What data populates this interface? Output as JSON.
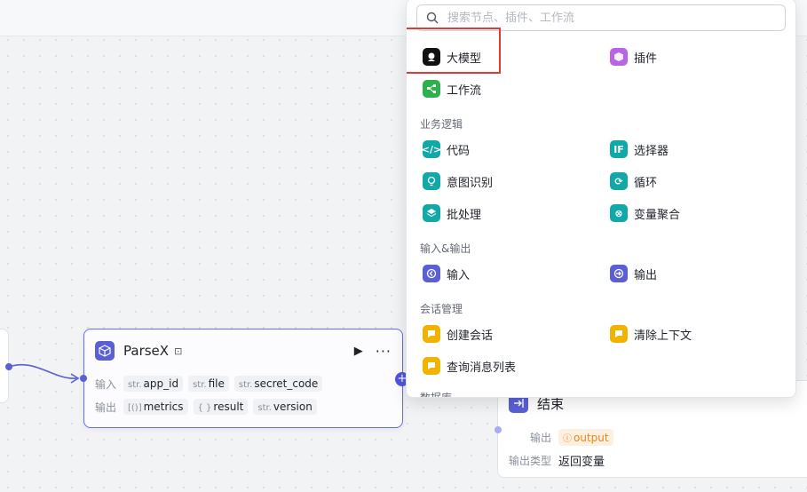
{
  "search": {
    "placeholder": "搜索节点、插件、工作流"
  },
  "menu": {
    "top_items": [
      {
        "label": "大模型",
        "icon": "llm-icon"
      },
      {
        "label": "插件",
        "icon": "plugin-icon"
      },
      {
        "label": "工作流",
        "icon": "workflow-icon"
      }
    ],
    "sections": [
      {
        "title": "业务逻辑",
        "items": [
          "代码",
          "选择器",
          "意图识别",
          "循环",
          "批处理",
          "变量聚合"
        ]
      },
      {
        "title": "输入&输出",
        "items": [
          "输入",
          "输出"
        ]
      },
      {
        "title": "会话管理",
        "items": [
          "创建会话",
          "清除上下文",
          "查询消息列表"
        ]
      },
      {
        "title": "数据库",
        "items": []
      }
    ]
  },
  "parsex": {
    "title": "ParseX",
    "input_label": "输入",
    "output_label": "输出",
    "inputs": [
      {
        "type": "str.",
        "name": "app_id"
      },
      {
        "type": "str.",
        "name": "file"
      },
      {
        "type": "str.",
        "name": "secret_code"
      }
    ],
    "outputs": [
      {
        "type": "[()]",
        "name": "metrics"
      },
      {
        "type": "{ }",
        "name": "result"
      },
      {
        "type": "str.",
        "name": "version"
      }
    ]
  },
  "end_node": {
    "title": "结束",
    "output_label": "输出",
    "output_value": "output",
    "output_type_label": "输出类型",
    "output_type_value": "返回变量"
  },
  "colors": {
    "accent": "#5a5fd6",
    "highlight": "#e53935"
  }
}
